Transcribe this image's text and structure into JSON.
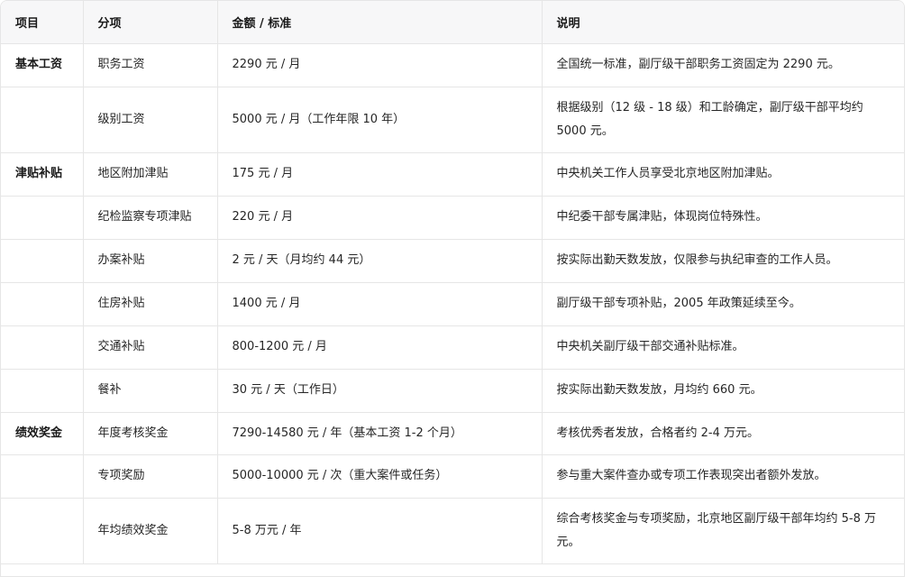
{
  "headers": [
    "项目",
    "分项",
    "金额 / 标准",
    "说明"
  ],
  "rows": [
    {
      "category": "基本工资",
      "item": "职务工资",
      "amount": "2290 元 / 月",
      "note": "全国统一标准，副厅级干部职务工资固定为 2290 元。"
    },
    {
      "category": "",
      "item": "级别工资",
      "amount": "5000 元 / 月（工作年限 10 年）",
      "note": "根据级别（12 级 - 18 级）和工龄确定，副厅级干部平均约 5000 元。"
    },
    {
      "category": "津贴补贴",
      "item": "地区附加津贴",
      "amount": "175 元 / 月",
      "note": "中央机关工作人员享受北京地区附加津贴。"
    },
    {
      "category": "",
      "item": "纪检监察专项津贴",
      "amount": "220 元 / 月",
      "note": "中纪委干部专属津贴，体现岗位特殊性。"
    },
    {
      "category": "",
      "item": "办案补贴",
      "amount": "2 元 / 天（月均约 44 元）",
      "note": "按实际出勤天数发放，仅限参与执纪审查的工作人员。"
    },
    {
      "category": "",
      "item": "住房补贴",
      "amount": "1400 元 / 月",
      "note": "副厅级干部专项补贴，2005 年政策延续至今。"
    },
    {
      "category": "",
      "item": "交通补贴",
      "amount": "800-1200 元 / 月",
      "note": "中央机关副厅级干部交通补贴标准。"
    },
    {
      "category": "",
      "item": "餐补",
      "amount": "30 元 / 天（工作日）",
      "note": "按实际出勤天数发放，月均约 660 元。"
    },
    {
      "category": "绩效奖金",
      "item": "年度考核奖金",
      "amount": "7290-14580 元 / 年（基本工资 1-2 个月）",
      "note": "考核优秀者发放，合格者约 2-4 万元。"
    },
    {
      "category": "",
      "item": "专项奖励",
      "amount": "5000-10000 元 / 次（重大案件或任务）",
      "note": "参与重大案件查办或专项工作表现突出者额外发放。"
    },
    {
      "category": "",
      "item": "年均绩效奖金",
      "amount": "5-8 万元 / 年",
      "note": "综合考核奖金与专项奖励，北京地区副厅级干部年均约 5-8 万元。"
    }
  ]
}
